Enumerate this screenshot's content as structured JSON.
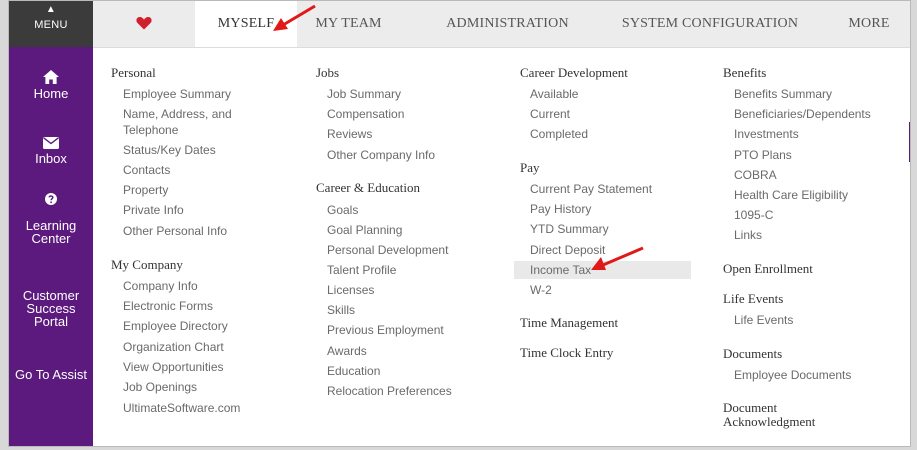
{
  "topbar": {
    "menu_caret": "▲",
    "menu_label": "MENU",
    "tabs": [
      "MYSELF",
      "MY TEAM",
      "ADMINISTRATION",
      "SYSTEM CONFIGURATION",
      "MORE"
    ]
  },
  "sidenav": {
    "home": "Home",
    "inbox": "Inbox",
    "learning": [
      "Learning",
      "Center"
    ],
    "customer": [
      "Customer",
      "Success",
      "Portal"
    ],
    "assist": "Go To Assist"
  },
  "col1": {
    "personal": "Personal",
    "personal_items": [
      "Employee Summary",
      "Name, Address, and",
      "Telephone",
      "Status/Key Dates",
      "Contacts",
      "Property",
      "Private Info",
      "Other Personal Info"
    ],
    "mycompany": "My Company",
    "mycompany_items": [
      "Company Info",
      "Electronic Forms",
      "Employee Directory",
      "Organization Chart",
      "View Opportunities",
      "Job Openings",
      "UltimateSoftware.com"
    ]
  },
  "col2": {
    "jobs": "Jobs",
    "jobs_items": [
      "Job Summary",
      "Compensation",
      "Reviews",
      "Other Company Info"
    ],
    "career": "Career & Education",
    "career_items": [
      "Goals",
      "Goal Planning",
      "Personal Development",
      "Talent Profile",
      "Licenses",
      "Skills",
      "Previous Employment",
      "Awards",
      "Education",
      "Relocation Preferences"
    ]
  },
  "col3": {
    "careerdev": "Career Development",
    "careerdev_items": [
      "Available",
      "Current",
      "Completed"
    ],
    "pay": "Pay",
    "pay_items": [
      "Current Pay Statement",
      "Pay History",
      "YTD Summary",
      "Direct Deposit",
      "Income Tax",
      "W-2"
    ],
    "time_mgmt": "Time Management",
    "time_clock": "Time Clock Entry"
  },
  "col4": {
    "benefits": "Benefits",
    "benefits_items": [
      "Benefits Summary",
      "Beneficiaries/Dependents",
      "Investments",
      "PTO Plans",
      "COBRA",
      "Health Care Eligibility",
      "1095-C",
      "Links"
    ],
    "open_enrollment": "Open Enrollment",
    "life_events": "Life Events",
    "life_events_items": [
      "Life Events"
    ],
    "documents": "Documents",
    "documents_items": [
      "Employee Documents"
    ],
    "doc_ack": [
      "Document",
      "Acknowledgment"
    ]
  },
  "colors": {
    "purple": "#5c1a7e",
    "dark": "#3b3b3b",
    "heart": "#d0202e",
    "arrow": "#e01818"
  },
  "icons": [
    "caret-up-icon",
    "heart-icon",
    "home-icon",
    "envelope-icon",
    "question-icon",
    "arrow-annotation-icon"
  ]
}
